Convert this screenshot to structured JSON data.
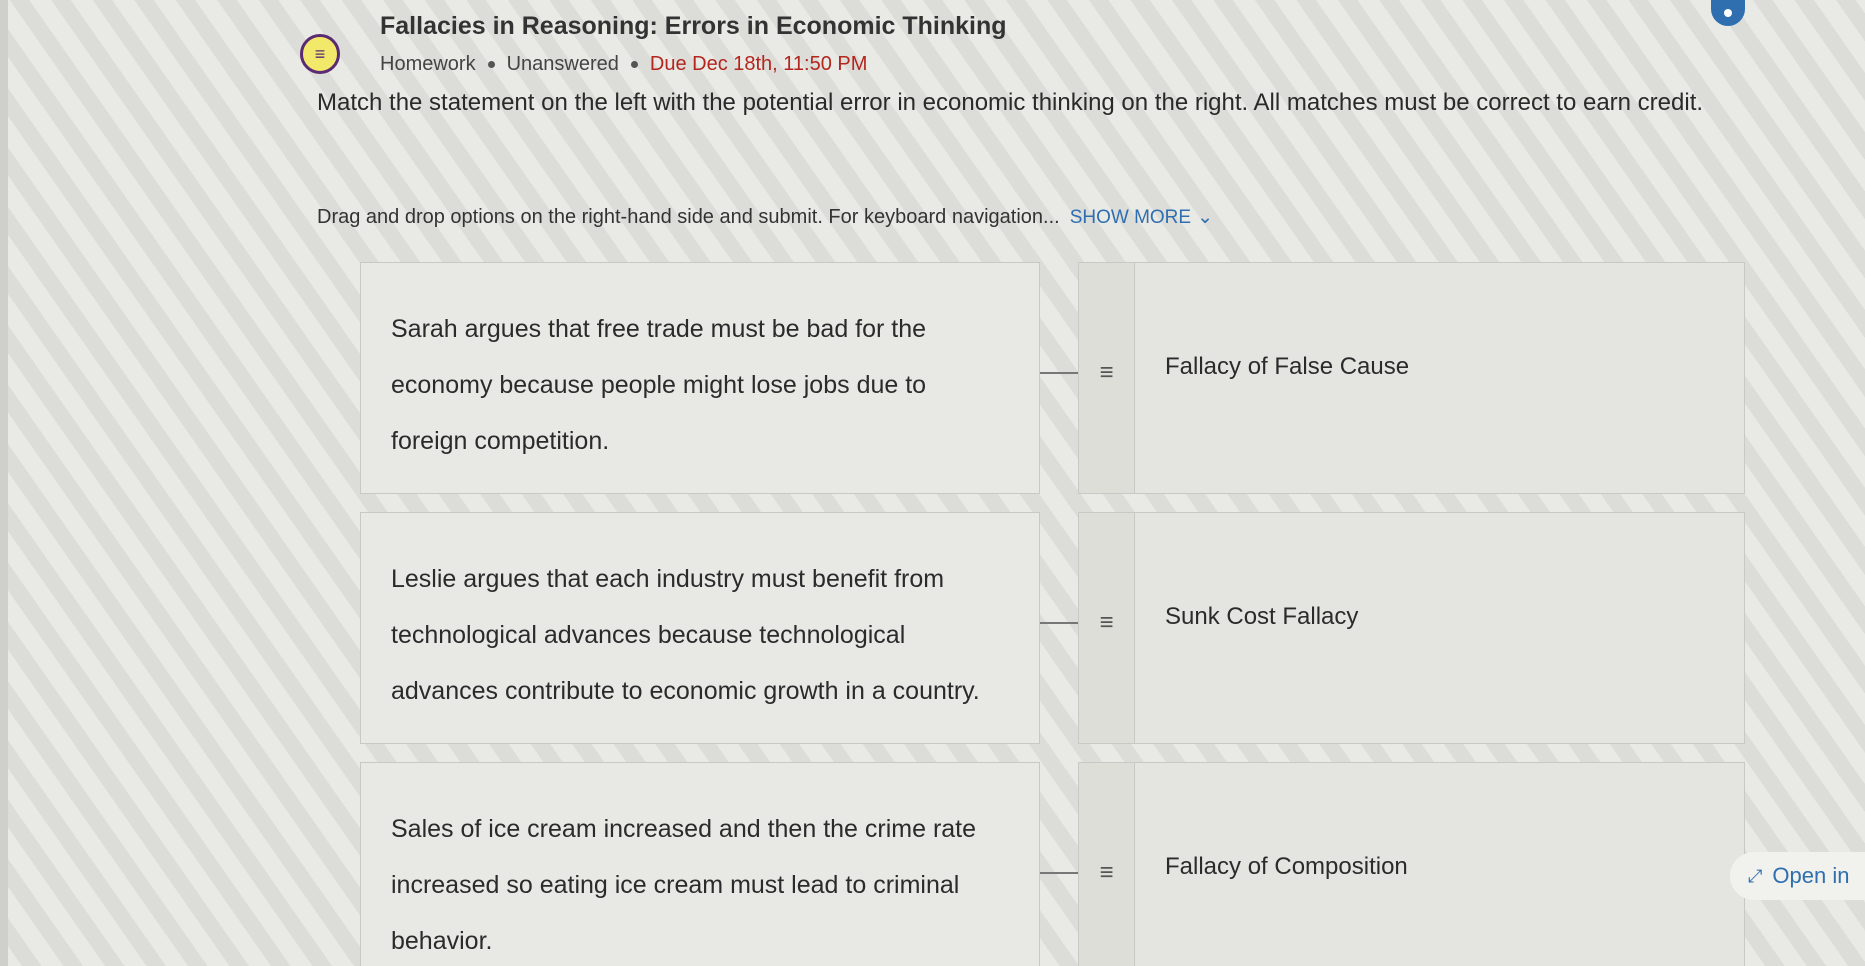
{
  "header": {
    "title": "Fallacies in Reasoning: Errors in Economic Thinking",
    "type": "Homework",
    "status": "Unanswered",
    "due": "Due Dec 18th, 11:50 PM",
    "type_icon": "list-icon"
  },
  "question": {
    "prompt": "Match the statement on the left with the potential error in economic thinking on the right. All matches must be correct to earn credit.",
    "instructions": "Drag and drop options on the right-hand side and submit. For keyboard navigation...",
    "show_more": "SHOW MORE"
  },
  "pairs": [
    {
      "statement": "Sarah argues that free trade must be bad for the economy because people might lose jobs due to foreign competition.",
      "option": "Fallacy of False Cause"
    },
    {
      "statement": "Leslie argues that each industry must benefit from technological advances because technological advances contribute to economic growth in a country.",
      "option": "Sunk Cost Fallacy"
    },
    {
      "statement": "Sales of ice cream increased and then the crime rate increased so eating ice cream must lead to criminal behavior.",
      "option": "Fallacy of Composition"
    }
  ],
  "open_in": {
    "label": "Open in"
  },
  "colors": {
    "accent": "#2f6fb0",
    "due": "#b3261e",
    "icon_bg": "#f2e96a",
    "icon_border": "#5a2a73"
  }
}
